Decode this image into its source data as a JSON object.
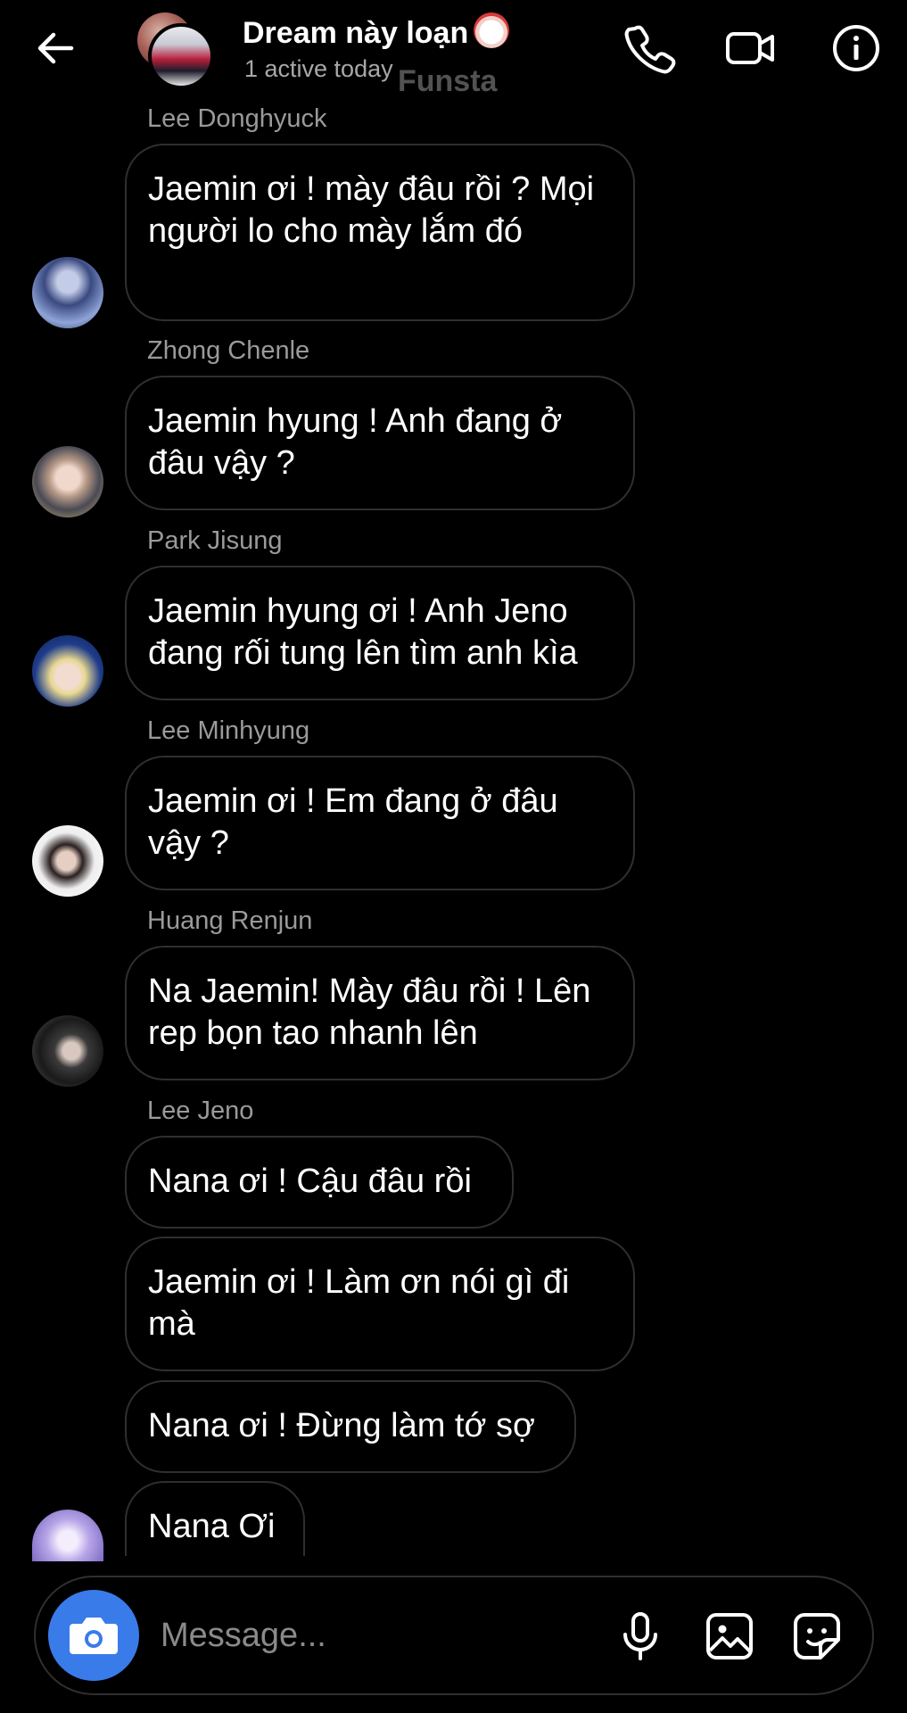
{
  "header": {
    "title": "Dream này loạn",
    "subtitle": "1 active today",
    "watermark": "Funsta",
    "icons": [
      "back-arrow-icon",
      "phone-icon",
      "video-camera-icon",
      "info-icon"
    ]
  },
  "messages": [
    {
      "sender": "Lee Donghyuck",
      "bubbles": [
        {
          "text": "Jaemin ơi ! mày đâu rồi ? Mọi người lo cho mày lắm đó"
        }
      ]
    },
    {
      "sender": "Zhong Chenle",
      "bubbles": [
        {
          "text": "Jaemin hyung ! Anh đang ở đâu vậy ?"
        }
      ]
    },
    {
      "sender": "Park Jisung",
      "bubbles": [
        {
          "text": "Jaemin hyung ơi ! Anh Jeno đang rối tung lên tìm anh kìa"
        }
      ]
    },
    {
      "sender": "Lee Minhyung",
      "bubbles": [
        {
          "text": "Jaemin ơi ! Em đang ở đâu vậy ?"
        }
      ]
    },
    {
      "sender": "Huang Renjun",
      "bubbles": [
        {
          "text": "Na Jaemin! Mày đâu rồi ! Lên rep bọn tao nhanh lên"
        }
      ]
    },
    {
      "sender": "Lee Jeno",
      "bubbles": [
        {
          "text": "Nana ơi ! Cậu đâu rồi"
        },
        {
          "text": "Jaemin ơi ! Làm ơn nói gì đi mà"
        },
        {
          "text": "Nana ơi ! Đừng làm tớ sợ"
        },
        {
          "text": "Nana Ơi"
        }
      ]
    }
  ],
  "composer": {
    "placeholder": "Message...",
    "icons": [
      "camera-icon",
      "microphone-icon",
      "gallery-icon",
      "sticker-icon"
    ]
  },
  "colors": {
    "background": "#000000",
    "accent": "#3a7bea",
    "bubble_border": "#2f2f2f",
    "muted_text": "#9a9a9a"
  }
}
